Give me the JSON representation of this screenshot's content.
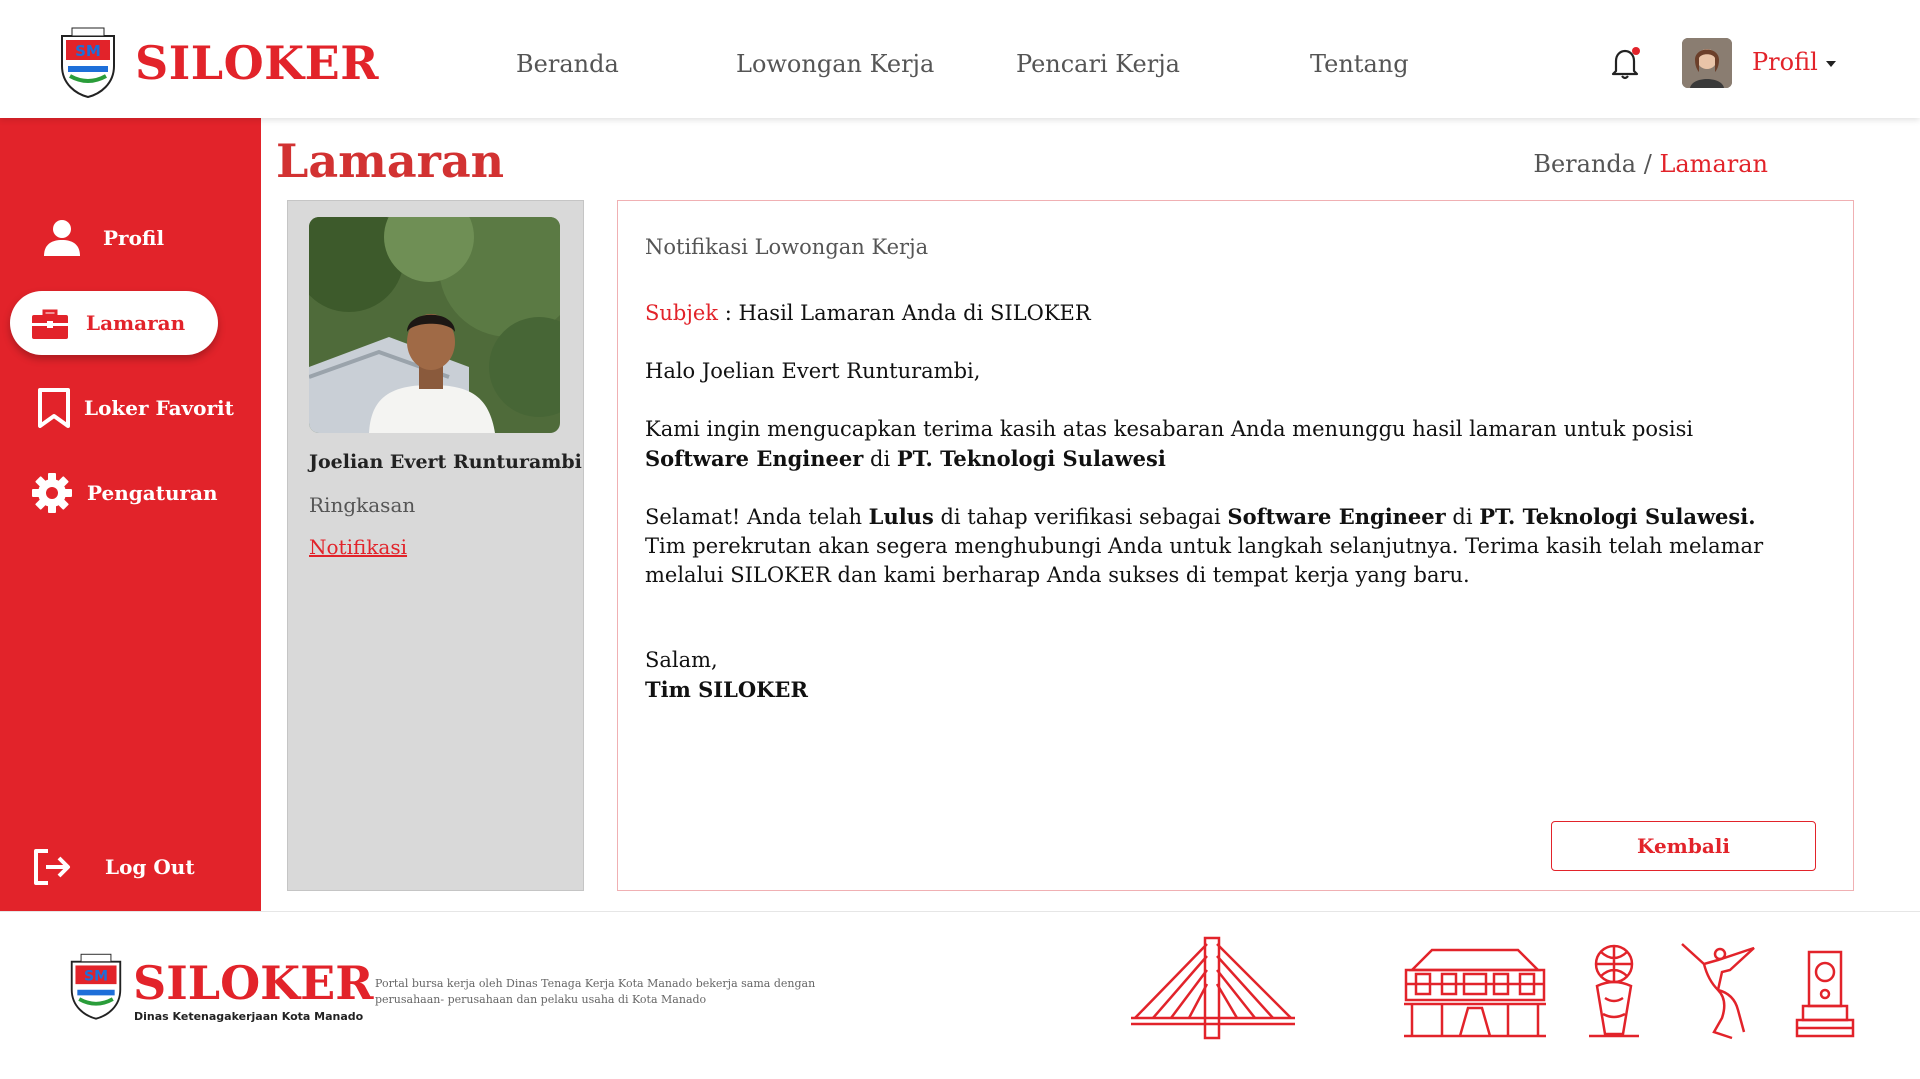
{
  "header": {
    "brand": "SILOKER",
    "nav": [
      "Beranda",
      "Lowongan Kerja",
      "Pencari Kerja",
      "Tentang"
    ],
    "profile_label": "Profil"
  },
  "sidebar": {
    "items": [
      {
        "label": "Profil",
        "icon": "user-icon"
      },
      {
        "label": "Lamaran",
        "icon": "briefcase-icon",
        "active": true
      },
      {
        "label": "Loker Favorit",
        "icon": "bookmark-icon"
      },
      {
        "label": "Pengaturan",
        "icon": "gear-icon"
      }
    ],
    "logout": "Log Out"
  },
  "page": {
    "title": "Lamaran",
    "breadcrumb_home": "Beranda",
    "breadcrumb_sep": " / ",
    "breadcrumb_current": "Lamaran"
  },
  "profile_card": {
    "name": "Joelian Evert Runturambi",
    "summary_link": "Ringkasan",
    "notif_link": "Notifikasi"
  },
  "message": {
    "heading": "Notifikasi Lowongan Kerja",
    "subject_label": "Subjek",
    "subject_sep": " : ",
    "subject": "Hasil Lamaran Anda di SILOKER",
    "greeting": "Halo Joelian Evert Runturambi,",
    "p1_text": "Kami ingin mengucapkan terima kasih atas kesabaran Anda menunggu hasil lamaran untuk posisi ",
    "position": "Software Engineer",
    "di": " di ",
    "company": "PT. Teknologi Sulawesi",
    "p2_a": "Selamat! Anda telah ",
    "status": "Lulus",
    "p2_b": " di tahap verifikasi sebagai ",
    "company_dot": "PT. Teknologi Sulawesi.",
    "p2_c": " Tim perekrutan akan segera menghubungi Anda untuk langkah selanjutnya. Terima kasih telah melamar melalui SILOKER dan kami berharap Anda sukses di tempat kerja yang baru.",
    "closing": "Salam,",
    "signature": "Tim SILOKER",
    "back_button": "Kembali"
  },
  "footer": {
    "brand": "SILOKER",
    "subtitle": "Dinas Ketenagakerjaan Kota Manado",
    "description": "Portal bursa kerja oleh Dinas Tenaga Kerja Kota Manado bekerja sama dengan perusahaan- perusahaan dan pelaku usaha di Kota Manado"
  },
  "colors": {
    "primary": "#e2232a",
    "card_bg": "#d9d9d9"
  }
}
